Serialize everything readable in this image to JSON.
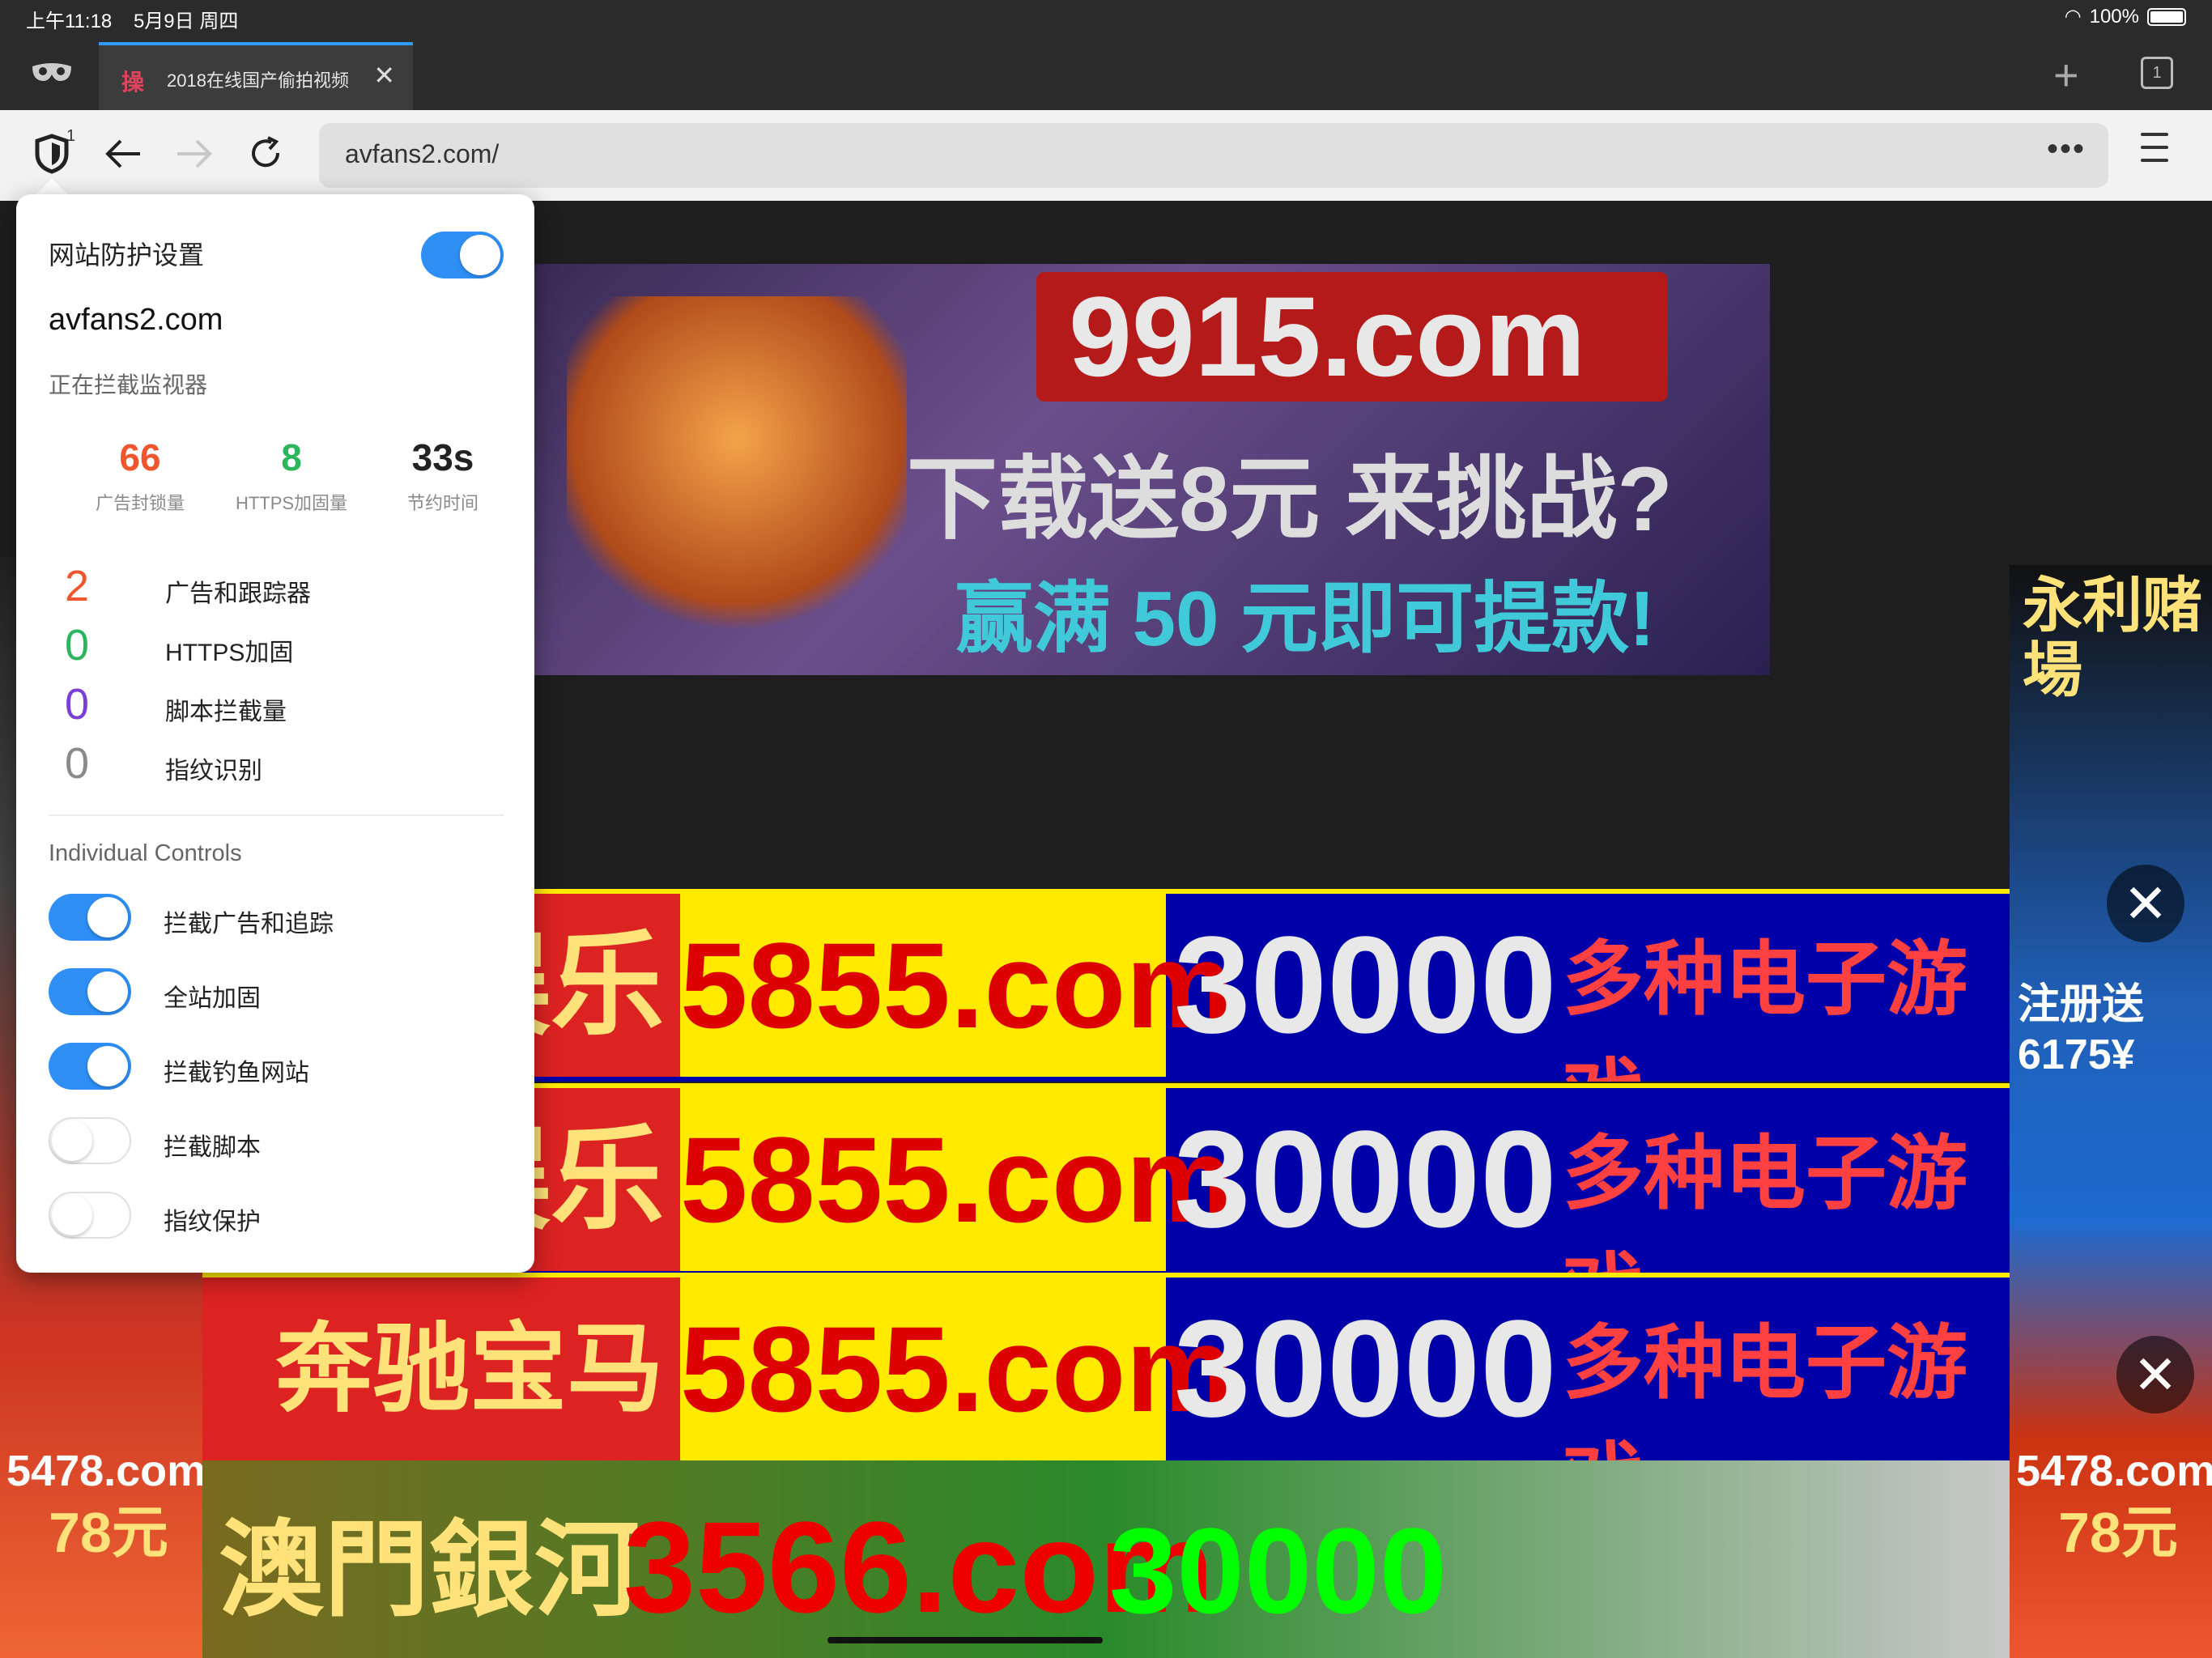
{
  "status_bar": {
    "time": "上午11:18",
    "date": "5月9日 周四",
    "battery": "100%"
  },
  "tabs": [
    {
      "favicon": "操",
      "title": "2018在线国产偷拍视频",
      "close": "✕"
    }
  ],
  "tab_bar": {
    "new_tab": "+",
    "tab_count": "1"
  },
  "toolbar": {
    "shield_badge": "1",
    "url": "avfans2.com/",
    "more": "•••"
  },
  "icons": {
    "private": "mask-icon",
    "shield": "shield-icon",
    "back": "back-arrow-icon",
    "forward": "forward-arrow-icon",
    "reload": "reload-icon",
    "menu": "hamburger-icon"
  },
  "colors": {
    "accent": "#2f8ff5",
    "stat_ads": "#f0562e",
    "stat_https": "#2db55d",
    "scripts": "#7b3fd6",
    "fingerprint": "#8a8a8a"
  },
  "popup": {
    "title": "网站防护设置",
    "master_enabled": true,
    "domain": "avfans2.com",
    "subtitle": "正在拦截监视器",
    "stats": [
      {
        "value": "66",
        "label": "广告封锁量"
      },
      {
        "value": "8",
        "label": "HTTPS加固量"
      },
      {
        "value": "33s",
        "label": "节约时间"
      }
    ],
    "items": [
      {
        "count": "2",
        "label": "广告和跟踪器"
      },
      {
        "count": "0",
        "label": "HTTPS加固"
      },
      {
        "count": "0",
        "label": "脚本拦截量"
      },
      {
        "count": "0",
        "label": "指纹识别"
      }
    ],
    "section_title": "Individual Controls",
    "controls": [
      {
        "label": "拦截广告和追踪",
        "enabled": true
      },
      {
        "label": "全站加固",
        "enabled": true
      },
      {
        "label": "拦截钓鱼网站",
        "enabled": true
      },
      {
        "label": "拦截脚本",
        "enabled": false
      },
      {
        "label": "指纹保护",
        "enabled": false
      }
    ]
  },
  "page_ads": {
    "top_ad": {
      "code": "9915.com",
      "line1": "下载送8元 来挑战?",
      "line2": "赢满 50 元即可提款!"
    },
    "banner": {
      "left": "娱乐",
      "mid": "5855.com",
      "num": "30000",
      "right": "多种电子游戏"
    },
    "banner_3_left": "奔驰宝马娱乐",
    "side_right": {
      "title": "永利赌場",
      "promo": "注册送6175¥"
    },
    "side_common": {
      "brand": "5478.com",
      "amount": "78元"
    },
    "bottom": {
      "left": "澳門銀河",
      "mid": "3566.com",
      "num": "30000"
    },
    "close": "✕"
  }
}
